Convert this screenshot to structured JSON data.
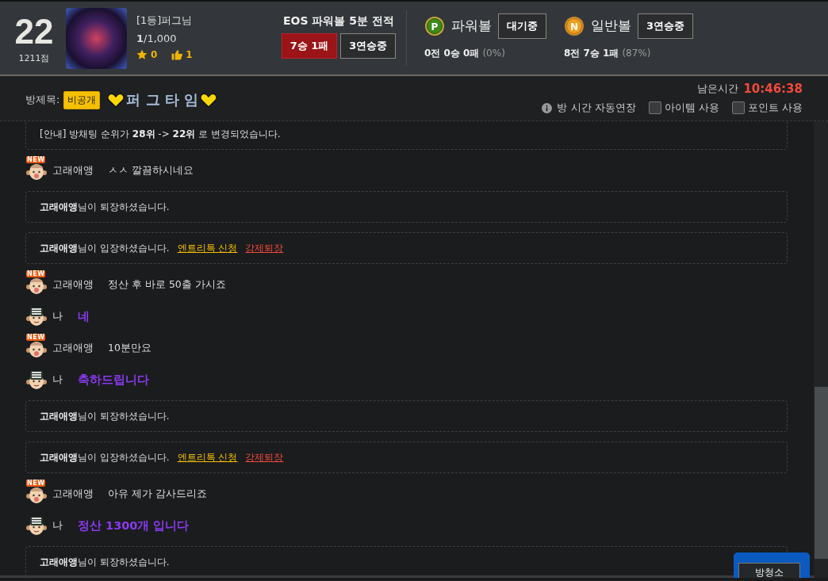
{
  "header": {
    "rank": "22",
    "score": "1211점",
    "user": {
      "title": "[1등]퍼그님",
      "points": "**1**/1,000",
      "stars": "0",
      "likes": "1"
    },
    "record": {
      "title": "EOS 파워볼 5분 전적",
      "result": "7승 1패",
      "streak": "3연승중"
    },
    "balls": [
      {
        "kind": "power",
        "coin": "P",
        "name": "파워볼",
        "status": "대기중",
        "record": "0전 0승 0패",
        "rate": "(0%)"
      },
      {
        "kind": "normal",
        "coin": "N",
        "name": "일반볼",
        "status": "3연승중",
        "record": "8전 7승 1패",
        "rate": "(87%)"
      }
    ]
  },
  "room": {
    "label": "방제목:",
    "privacy": "비공개",
    "title": "퍼 그 타 임",
    "time_label": "남은시간",
    "time": "10:46:38",
    "auto_extend": "방 시간 자동연장",
    "options": [
      {
        "label": "아이템 사용",
        "checked": false
      },
      {
        "label": "포인트 사용",
        "checked": false
      }
    ]
  },
  "messages": [
    {
      "kind": "notice",
      "text": "[안내] 방채팅 순위가 **28위** -> **22위** 로 변경되었습니다."
    },
    {
      "kind": "chat",
      "badge": "NEW",
      "name": "고래애앵",
      "text": "ㅅㅅ 깔끔하시네요"
    },
    {
      "kind": "notice",
      "text": "**고래애앵**님이 퇴장하셨습니다."
    },
    {
      "kind": "notice",
      "text": "**고래애앵**님이 입장하셨습니다.",
      "links": [
        {
          "kind": "apply",
          "label": "엔트리톡 신청"
        },
        {
          "kind": "kick",
          "label": "강제퇴장"
        }
      ]
    },
    {
      "kind": "chat",
      "badge": "NEW",
      "name": "고래애앵",
      "text": "정산 후 바로 50출 가시죠"
    },
    {
      "kind": "self",
      "name": "나",
      "text": "네"
    },
    {
      "kind": "chat",
      "badge": "NEW",
      "name": "고래애앵",
      "text": "10분만요"
    },
    {
      "kind": "self",
      "name": "나",
      "text": "축하드립니다"
    },
    {
      "kind": "notice",
      "text": "**고래애앵**님이 퇴장하셨습니다."
    },
    {
      "kind": "notice",
      "text": "**고래애앵**님이 입장하셨습니다.",
      "links": [
        {
          "kind": "apply",
          "label": "엔트리톡 신청"
        },
        {
          "kind": "kick",
          "label": "강제퇴장"
        }
      ]
    },
    {
      "kind": "chat",
      "badge": "NEW",
      "name": "고래애앵",
      "text": "아유 제가 감사드리죠"
    },
    {
      "kind": "self",
      "name": "나",
      "text": "정산 1300개 입니다"
    },
    {
      "kind": "notice",
      "text": "**고래애앵**님이 퇴장하셨습니다."
    }
  ],
  "footer": {
    "clean_button": "방청소"
  }
}
